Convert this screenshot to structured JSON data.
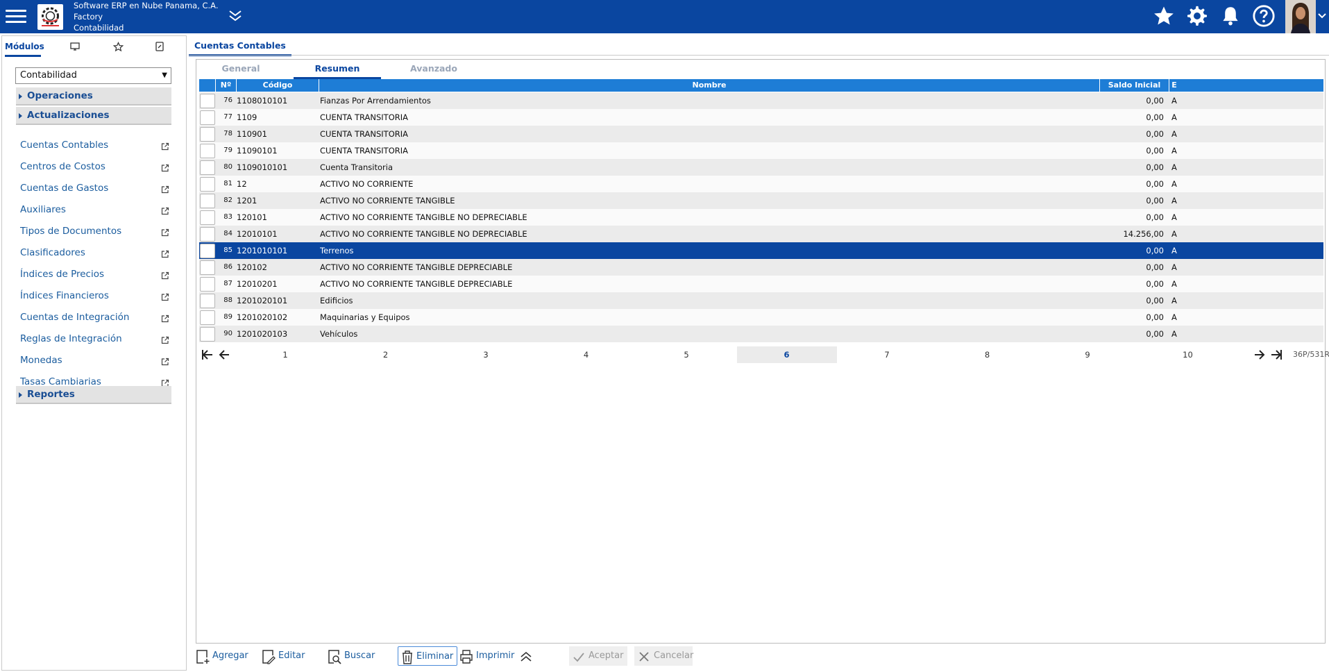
{
  "header": {
    "company": "Software ERP en Nube Panama, C.A.",
    "branch": "Factory",
    "module": "Contabilidad"
  },
  "sidebar": {
    "tabs": [
      {
        "label": "Módulos",
        "icon": ""
      },
      {
        "label": "",
        "icon": "monitor-icon"
      },
      {
        "label": "",
        "icon": "star-icon"
      },
      {
        "label": "",
        "icon": "document-icon"
      }
    ],
    "module_select": "Contabilidad",
    "sections": {
      "operaciones": "Operaciones",
      "actualizaciones": "Actualizaciones",
      "reportes": "Reportes"
    },
    "items": [
      {
        "label": "Cuentas Contables"
      },
      {
        "label": "Centros de Costos"
      },
      {
        "label": "Cuentas de Gastos"
      },
      {
        "label": "Auxiliares"
      },
      {
        "label": "Tipos de Documentos"
      },
      {
        "label": "Clasificadores"
      },
      {
        "label": "Índices de Precios"
      },
      {
        "label": "Índices Financieros"
      },
      {
        "label": "Cuentas de Integración"
      },
      {
        "label": "Reglas de Integración"
      },
      {
        "label": "Monedas"
      },
      {
        "label": "Tasas Cambiarias"
      }
    ]
  },
  "main": {
    "tab": "Cuentas Contables",
    "subtabs": {
      "general": "General",
      "resumen": "Resumen",
      "avanzado": "Avanzado"
    },
    "columns": {
      "no": "Nº",
      "code": "Código",
      "name": "Nombre",
      "saldo": "Saldo Inicial",
      "e": "E"
    },
    "rows": [
      {
        "no": "76",
        "code": "1108010101",
        "name": "Fianzas Por Arrendamientos",
        "saldo": "0,00",
        "e": "A"
      },
      {
        "no": "77",
        "code": "1109",
        "name": "CUENTA TRANSITORIA",
        "saldo": "0,00",
        "e": "A"
      },
      {
        "no": "78",
        "code": "110901",
        "name": "CUENTA TRANSITORIA",
        "saldo": "0,00",
        "e": "A"
      },
      {
        "no": "79",
        "code": "11090101",
        "name": "CUENTA TRANSITORIA",
        "saldo": "0,00",
        "e": "A"
      },
      {
        "no": "80",
        "code": "1109010101",
        "name": "Cuenta Transitoria",
        "saldo": "0,00",
        "e": "A"
      },
      {
        "no": "81",
        "code": "12",
        "name": "ACTIVO NO CORRIENTE",
        "saldo": "0,00",
        "e": "A"
      },
      {
        "no": "82",
        "code": "1201",
        "name": "ACTIVO NO CORRIENTE TANGIBLE",
        "saldo": "0,00",
        "e": "A"
      },
      {
        "no": "83",
        "code": "120101",
        "name": "ACTIVO NO CORRIENTE TANGIBLE NO DEPRECIABLE",
        "saldo": "0,00",
        "e": "A"
      },
      {
        "no": "84",
        "code": "12010101",
        "name": "ACTIVO NO CORRIENTE TANGIBLE NO DEPRECIABLE",
        "saldo": "14.256,00",
        "e": "A"
      },
      {
        "no": "85",
        "code": "1201010101",
        "name": "Terrenos",
        "saldo": "0,00",
        "e": "A"
      },
      {
        "no": "86",
        "code": "120102",
        "name": "ACTIVO NO CORRIENTE TANGIBLE DEPRECIABLE",
        "saldo": "0,00",
        "e": "A"
      },
      {
        "no": "87",
        "code": "12010201",
        "name": "ACTIVO NO CORRIENTE TANGIBLE DEPRECIABLE",
        "saldo": "0,00",
        "e": "A"
      },
      {
        "no": "88",
        "code": "1201020101",
        "name": "Edificios",
        "saldo": "0,00",
        "e": "A"
      },
      {
        "no": "89",
        "code": "1201020102",
        "name": "Maquinarias y Equipos",
        "saldo": "0,00",
        "e": "A"
      },
      {
        "no": "90",
        "code": "1201020103",
        "name": "Vehículos",
        "saldo": "0,00",
        "e": "A"
      }
    ],
    "pager": {
      "pages": [
        "1",
        "2",
        "3",
        "4",
        "5",
        "6",
        "7",
        "8",
        "9",
        "10"
      ],
      "current": "6",
      "info": "36P/531R"
    }
  },
  "toolbar": {
    "add": "Agregar",
    "edit": "Editar",
    "search": "Buscar",
    "delete": "Eliminar",
    "print": "Imprimir",
    "accept": "Aceptar",
    "cancel": "Cancelar"
  },
  "colors": {
    "brand": "#0a46a0",
    "header_row": "#1e7dd6",
    "selected_row": "#0a46a0"
  }
}
